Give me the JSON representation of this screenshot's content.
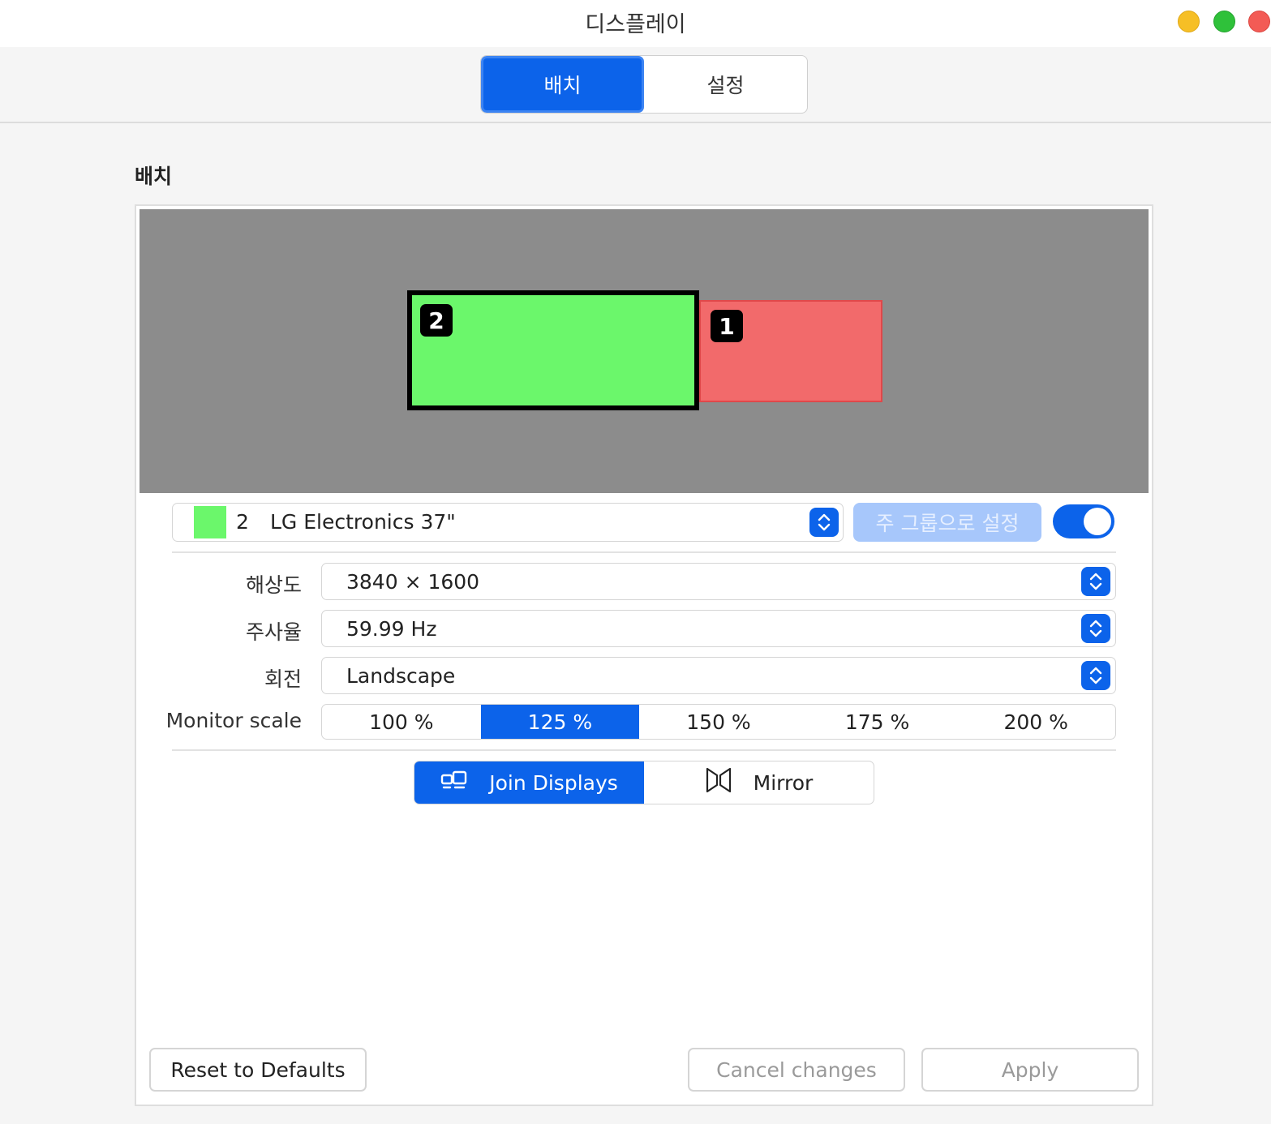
{
  "window": {
    "title": "디스플레이",
    "controls": [
      "minimize",
      "maximize",
      "close"
    ]
  },
  "top_tabs": [
    {
      "label": "배치",
      "active": true
    },
    {
      "label": "설정",
      "active": false
    }
  ],
  "section": {
    "title": "배치"
  },
  "arrangement": {
    "monitors": [
      {
        "number": "2",
        "color": "#6bf76b",
        "selected": true
      },
      {
        "number": "1",
        "color": "#f26a6b",
        "selected": false
      }
    ],
    "background": "#8c8c8c"
  },
  "display_selector": {
    "number": "2",
    "name": "LG Electronics 37\"",
    "swatch_color": "#6bf76b",
    "icon": "up-down-chevron-icon"
  },
  "primary_button": {
    "label": "주 그룹으로 설정",
    "enabled": false
  },
  "toggle": {
    "on": true
  },
  "settings": {
    "resolution": {
      "label": "해상도",
      "value": "3840 × 1600"
    },
    "refresh_rate": {
      "label": "주사율",
      "value": "59.99 Hz"
    },
    "rotation": {
      "label": "회전",
      "value": "Landscape"
    },
    "monitor_scale": {
      "label": "Monitor scale",
      "options": [
        "100 %",
        "125 %",
        "150 %",
        "175 %",
        "200 %"
      ],
      "selected": "125 %"
    }
  },
  "mode": {
    "join_label": "Join Displays",
    "mirror_label": "Mirror",
    "selected": "Join Displays"
  },
  "buttons": {
    "reset": "Reset to Defaults",
    "cancel": "Cancel changes",
    "apply": "Apply"
  },
  "colors": {
    "accent": "#0c63ea",
    "disabled_accent": "#a7c7fb"
  }
}
